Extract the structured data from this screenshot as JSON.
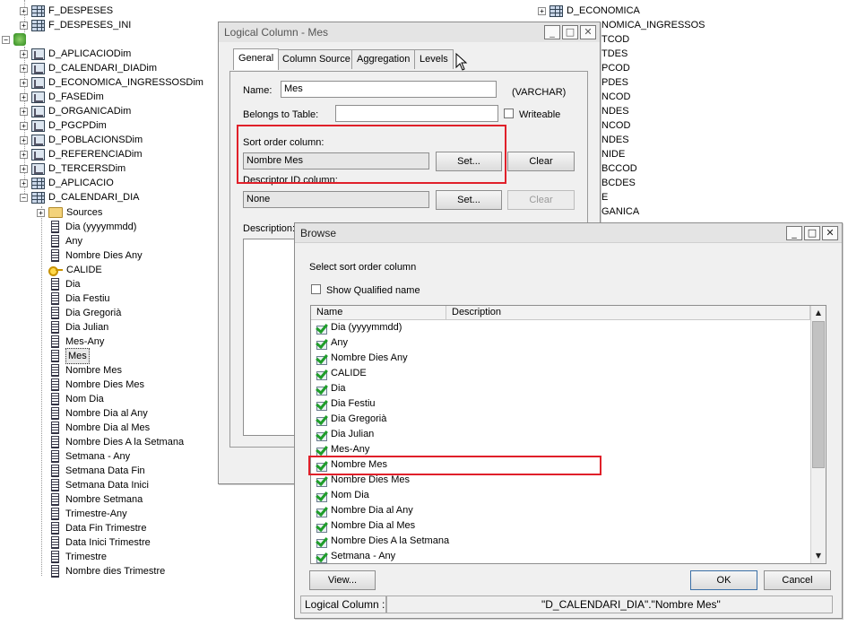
{
  "left_tree": {
    "top_items": [
      {
        "label": "F_DESPESES",
        "y": 12
      },
      {
        "label": "F_DESPESES_INI",
        "y": 28
      }
    ],
    "dims": [
      "D_APLICACIODim",
      "D_CALENDARI_DIADim",
      "D_ECONOMICA_INGRESSOSDim",
      "D_FASEDim",
      "D_ORGANICADim",
      "D_PGCPDim",
      "D_POBLACIONSDim",
      "D_REFERENCIADim",
      "D_TERCERSDim"
    ],
    "tables": [
      "D_APLICACIO",
      "D_CALENDARI_DIA"
    ],
    "sources_label": "Sources",
    "columns": [
      "Dia (yyyymmdd)",
      "Any",
      "Nombre Dies Any",
      "CALIDE",
      "Dia",
      "Dia Festiu",
      "Dia Gregorià",
      "Dia Julian",
      "Mes-Any",
      "Mes",
      "Nombre Mes",
      "Nombre Dies Mes",
      "Nom Dia",
      "Nombre Dia al Any",
      "Nombre Dia al Mes",
      "Nombre Dies A la Setmana",
      "Setmana - Any",
      "Setmana Data Fin",
      "Setmana Data Inici",
      "Nombre Setmana",
      "Trimestre-Any",
      "Data Fin Trimestre",
      "Data Inici Trimestre",
      "Trimestre",
      "Nombre dies Trimestre"
    ],
    "key_column": "CALIDE",
    "selected_column": "Mes"
  },
  "right_tree": {
    "header_item": "D_ECONOMICA",
    "fragments": [
      "NOMICA_INGRESSOS",
      "TCOD",
      "TDES",
      "PCOD",
      "PDES",
      "NCOD",
      "NDES",
      "NCOD",
      "NDES",
      "NIDE",
      "BCCOD",
      "BCDES",
      "E",
      "GANICA"
    ]
  },
  "logical_column": {
    "title": "Logical Column - Mes",
    "tabs": [
      "General",
      "Column Source",
      "Aggregation",
      "Levels"
    ],
    "active_tab": "General",
    "name_label": "Name:",
    "name_value": "Mes",
    "type_label": "(VARCHAR)",
    "belongs_label": "Belongs to Table:",
    "belongs_value": "",
    "writeable_label": "Writeable",
    "sort_label": "Sort order column:",
    "sort_value": "Nombre Mes",
    "set_label": "Set...",
    "clear_label": "Clear",
    "descriptor_label": "Descriptor ID column:",
    "descriptor_value": "None",
    "description_label": "Description:"
  },
  "browse": {
    "title": "Browse",
    "prompt": "Select sort order column",
    "show_qualified_label": "Show Qualified name",
    "col_name": "Name",
    "col_description": "Description",
    "items": [
      "Dia (yyyymmdd)",
      "Any",
      "Nombre Dies Any",
      "CALIDE",
      "Dia",
      "Dia Festiu",
      "Dia Gregorià",
      "Dia Julian",
      "Mes-Any",
      "Nombre Mes",
      "Nombre Dies Mes",
      "Nom Dia",
      "Nombre Dia al Any",
      "Nombre Dia al Mes",
      "Nombre Dies A la Setmana",
      "Setmana - Any"
    ],
    "highlighted_item": "Nombre Mes",
    "view_label": "View...",
    "ok_label": "OK",
    "cancel_label": "Cancel",
    "status_label": "Logical Column :",
    "status_value": "\"D_CALENDARI_DIA\".\"Nombre Mes\""
  },
  "colors": {
    "highlight_red": "#e0202a",
    "check_green": "#1f9d2a"
  }
}
